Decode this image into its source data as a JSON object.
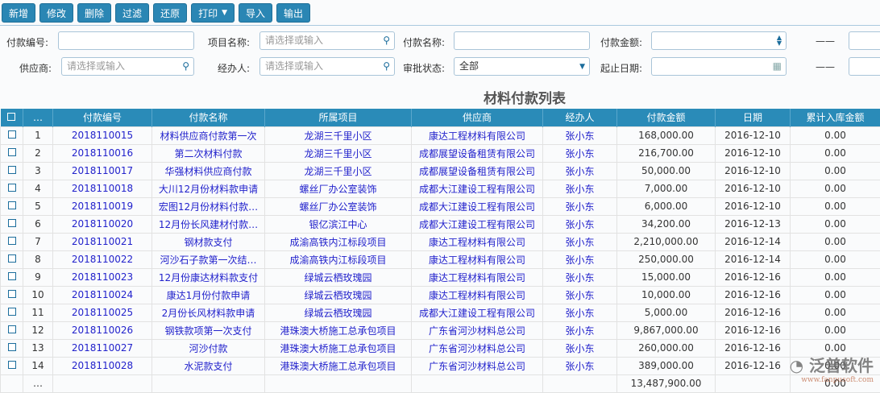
{
  "toolbar": {
    "buttons": [
      "新增",
      "修改",
      "删除",
      "过滤",
      "还原",
      "打印",
      "导入",
      "输出"
    ]
  },
  "filters": {
    "payment_code": {
      "label": "付款编号:",
      "value": ""
    },
    "project": {
      "label": "项目名称:",
      "placeholder": "请选择或输入"
    },
    "payment_name": {
      "label": "付款名称:",
      "value": ""
    },
    "amount": {
      "label": "付款金额:",
      "dash": "——"
    },
    "supplier": {
      "label": "供应商:",
      "placeholder": "请选择或输入"
    },
    "handler": {
      "label": "经办人:",
      "placeholder": "请选择或输入"
    },
    "approval": {
      "label": "审批状态:",
      "value": "全部"
    },
    "date": {
      "label": "起止日期:",
      "dash": "——"
    }
  },
  "table": {
    "title": "材料付款列表",
    "headers": [
      "…",
      "付款编号",
      "付款名称",
      "所属项目",
      "供应商",
      "经办人",
      "付款金额",
      "日期",
      "累计入库金额"
    ],
    "rows": [
      [
        "1",
        "2018110015",
        "材料供应商付款第一次",
        "龙湖三千里小区",
        "康达工程材料有限公司",
        "张小东",
        "168,000.00",
        "2016-12-10",
        "0.00"
      ],
      [
        "2",
        "2018110016",
        "第二次材料付款",
        "龙湖三千里小区",
        "成都展望设备租赁有限公司",
        "张小东",
        "216,700.00",
        "2016-12-10",
        "0.00"
      ],
      [
        "3",
        "2018110017",
        "华强材料供应商付款",
        "龙湖三千里小区",
        "成都展望设备租赁有限公司",
        "张小东",
        "50,000.00",
        "2016-12-10",
        "0.00"
      ],
      [
        "4",
        "2018110018",
        "大川12月份材料款申请",
        "螺丝厂办公室装饰",
        "成都大江建设工程有限公司",
        "张小东",
        "7,000.00",
        "2016-12-10",
        "0.00"
      ],
      [
        "5",
        "2018110019",
        "宏图12月份材料付款…",
        "螺丝厂办公室装饰",
        "成都大江建设工程有限公司",
        "张小东",
        "6,000.00",
        "2016-12-10",
        "0.00"
      ],
      [
        "6",
        "2018110020",
        "12月份长风建材付款…",
        "银亿滨江中心",
        "成都大江建设工程有限公司",
        "张小东",
        "34,200.00",
        "2016-12-13",
        "0.00"
      ],
      [
        "7",
        "2018110021",
        "钢材款支付",
        "成渝高铁内江标段项目",
        "康达工程材料有限公司",
        "张小东",
        "2,210,000.00",
        "2016-12-14",
        "0.00"
      ],
      [
        "8",
        "2018110022",
        "河沙石子款第一次结…",
        "成渝高铁内江标段项目",
        "康达工程材料有限公司",
        "张小东",
        "250,000.00",
        "2016-12-14",
        "0.00"
      ],
      [
        "9",
        "2018110023",
        "12月份康达材料款支付",
        "绿城云栖玫瑰园",
        "康达工程材料有限公司",
        "张小东",
        "15,000.00",
        "2016-12-16",
        "0.00"
      ],
      [
        "10",
        "2018110024",
        "康达1月份付款申请",
        "绿城云栖玫瑰园",
        "康达工程材料有限公司",
        "张小东",
        "10,000.00",
        "2016-12-16",
        "0.00"
      ],
      [
        "11",
        "2018110025",
        "2月份长风材料款申请",
        "绿城云栖玫瑰园",
        "成都大江建设工程有限公司",
        "张小东",
        "5,000.00",
        "2016-12-16",
        "0.00"
      ],
      [
        "12",
        "2018110026",
        "钢铁款项第一次支付",
        "港珠澳大桥施工总承包项目",
        "广东省河沙材料总公司",
        "张小东",
        "9,867,000.00",
        "2016-12-16",
        "0.00"
      ],
      [
        "13",
        "2018110027",
        "河沙付款",
        "港珠澳大桥施工总承包项目",
        "广东省河沙材料总公司",
        "张小东",
        "260,000.00",
        "2016-12-16",
        "0.00"
      ],
      [
        "14",
        "2018110028",
        "水泥款支付",
        "港珠澳大桥施工总承包项目",
        "广东省河沙材料总公司",
        "张小东",
        "389,000.00",
        "2016-12-16",
        "0.00"
      ]
    ],
    "total": {
      "idx": "…",
      "amount": "13,487,900.00",
      "cum": "0.00"
    }
  },
  "watermark": {
    "brand": "泛普软件",
    "url": "www.fanpusoft.com"
  }
}
